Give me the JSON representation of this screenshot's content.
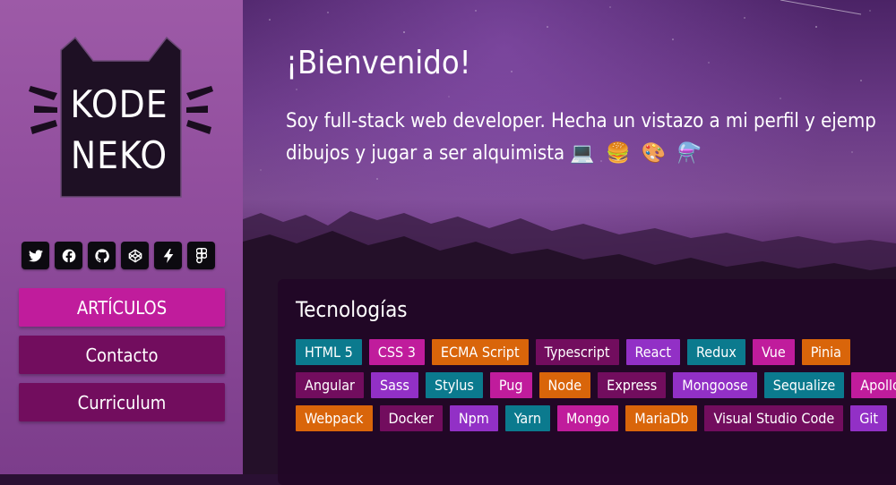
{
  "brand": {
    "line1": "KODE",
    "line2": "NEKO"
  },
  "socials": [
    {
      "icon": "twitter-icon"
    },
    {
      "icon": "facebook-icon"
    },
    {
      "icon": "github-icon"
    },
    {
      "icon": "codepen-icon"
    },
    {
      "icon": "bolt-icon"
    },
    {
      "icon": "figma-icon"
    }
  ],
  "nav": [
    {
      "label": "ARTÍCULOS",
      "active": true
    },
    {
      "label": "Contacto",
      "active": false
    },
    {
      "label": "Curriculum",
      "active": false
    }
  ],
  "hero": {
    "title": "¡Bienvenido!",
    "line1": "Soy full-stack web developer. Hecha un vistazo a mi perfil y ejemp",
    "line2": "dibujos y jugar a ser alquimista",
    "emojis": [
      "💻",
      "🍔",
      "🎨",
      "⚗️"
    ]
  },
  "technologies": {
    "title": "Tecnologías",
    "tags": [
      {
        "label": "HTML 5",
        "color": "#0b7a8e"
      },
      {
        "label": "CSS 3",
        "color": "#c01c9c"
      },
      {
        "label": "ECMA Script",
        "color": "#d9650a"
      },
      {
        "label": "Typescript",
        "color": "#720d5e"
      },
      {
        "label": "React",
        "color": "#9230c6"
      },
      {
        "label": "Redux",
        "color": "#0b7a8e"
      },
      {
        "label": "Vue",
        "color": "#c01c9c"
      },
      {
        "label": "Pinia",
        "color": "#d9650a"
      },
      {
        "label": "Angular",
        "color": "#720d5e"
      },
      {
        "label": "Sass",
        "color": "#9230c6"
      },
      {
        "label": "Stylus",
        "color": "#0b7a8e"
      },
      {
        "label": "Pug",
        "color": "#c01c9c"
      },
      {
        "label": "Node",
        "color": "#d9650a"
      },
      {
        "label": "Express",
        "color": "#720d5e"
      },
      {
        "label": "Mongoose",
        "color": "#9230c6"
      },
      {
        "label": "Sequalize",
        "color": "#0b7a8e"
      },
      {
        "label": "Apollo",
        "color": "#c01c9c"
      },
      {
        "label": "Webpack",
        "color": "#d9650a"
      },
      {
        "label": "Docker",
        "color": "#720d5e"
      },
      {
        "label": "Npm",
        "color": "#9230c6"
      },
      {
        "label": "Yarn",
        "color": "#0b7a8e"
      },
      {
        "label": "Mongo",
        "color": "#c01c9c"
      },
      {
        "label": "MariaDb",
        "color": "#d9650a"
      },
      {
        "label": "Visual Studio Code",
        "color": "#720d5e"
      },
      {
        "label": "Git",
        "color": "#9230c6"
      }
    ]
  },
  "colors": {
    "sidebar": "#9d5aa7",
    "nav_active": "#c01c9c",
    "nav_default": "#720d5e",
    "card_bg": "#220626"
  }
}
